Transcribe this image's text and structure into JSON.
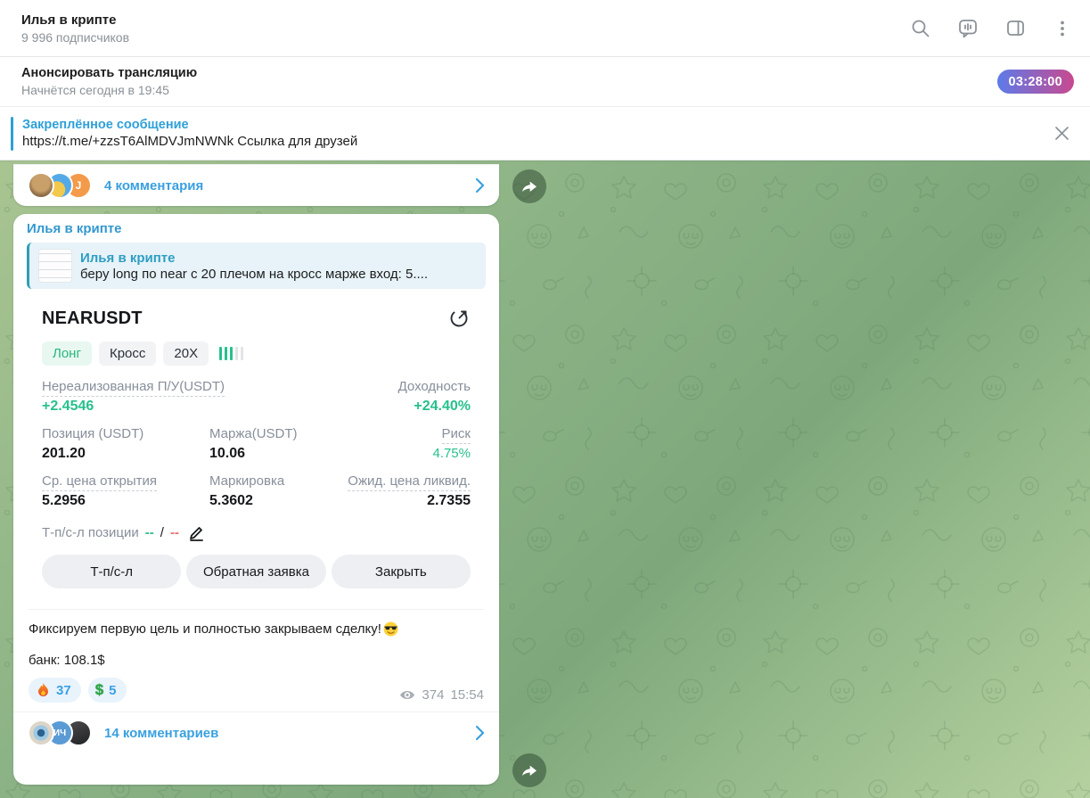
{
  "header": {
    "title": "Илья в крипте",
    "subtitle": "9 996 подписчиков"
  },
  "announce": {
    "title": "Анонсировать трансляцию",
    "subtitle": "Начнётся сегодня в 19:45",
    "countdown": "03:28:00"
  },
  "pinned": {
    "label": "Закреплённое сообщение",
    "text": "https://t.me/+zzsT6AlMDVJmNWNk  Ссылка для друзей"
  },
  "previous_message_footer": {
    "comments_label": "4 комментария",
    "avatar_initials": {
      "third": "J"
    }
  },
  "message": {
    "channel_name": "Илья в крипте",
    "reply_preview": {
      "author": "Илья в крипте",
      "text": "беру long по near с 20 плечом на кросс марже  вход: 5...."
    },
    "position_card": {
      "symbol": "NEARUSDT",
      "badges": [
        "Лонг",
        "Кросс",
        "20X"
      ],
      "risk_bars": {
        "active": 3,
        "total": 5
      },
      "fields": {
        "unrealized_pnl": {
          "label": "Нереализованная П/У(USDT)",
          "value": "+2.4546"
        },
        "roi": {
          "label": "Доходность",
          "value": "+24.40%"
        },
        "position": {
          "label": "Позиция (USDT)",
          "value": "201.20"
        },
        "margin": {
          "label": "Маржа(USDT)",
          "value": "10.06"
        },
        "risk": {
          "label": "Риск",
          "value": "4.75%"
        },
        "entry_price": {
          "label": "Ср. цена открытия",
          "value": "5.2956"
        },
        "mark_price": {
          "label": "Маркировка",
          "value": "5.3602"
        },
        "liq_price": {
          "label": "Ожид. цена ликвид.",
          "value": "2.7355"
        }
      },
      "tpsl": {
        "label": "Т-п/с-л позиции",
        "tp": "--",
        "separator": "/",
        "sl": "--"
      },
      "buttons": [
        "Т-п/с-л",
        "Обратная заявка",
        "Закрыть"
      ]
    },
    "text": "Фиксируем первую цель и полностью закрываем сделку!",
    "text_emoji": "😎",
    "text2": "банк: 108.1$",
    "reactions": [
      {
        "icon": "fire",
        "count": "37"
      },
      {
        "icon": "dollar",
        "count": "5"
      }
    ],
    "views": "374",
    "time": "15:54",
    "comments_label": "14 комментариев",
    "footer_avatar_initials": {
      "second": "ИЧ"
    }
  },
  "colors": {
    "accent_blue": "#3aa0e0",
    "green": "#27c08d",
    "red": "#f16a6a",
    "countdown_gradient": [
      "#5d7be9",
      "#c8498f"
    ],
    "background_green": "#8cb386"
  }
}
